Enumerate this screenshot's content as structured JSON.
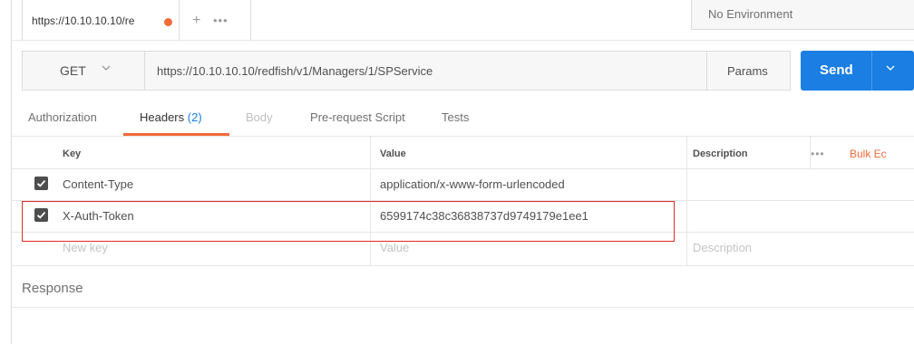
{
  "tabs": [
    {
      "title": "https://10.10.10.10/re",
      "unsaved": true
    }
  ],
  "tab_actions": {
    "add": "+",
    "more": "•••"
  },
  "environment": {
    "selected": "No Environment"
  },
  "request": {
    "method": "GET",
    "url": "https://10.10.10.10/redfish/v1/Managers/1/SPService",
    "params_label": "Params",
    "send_label": "Send"
  },
  "request_tabs": [
    {
      "label": "Authorization",
      "state": "normal"
    },
    {
      "label": "Headers",
      "count": "(2)",
      "state": "active"
    },
    {
      "label": "Body",
      "state": "disabled"
    },
    {
      "label": "Pre-request Script",
      "state": "normal"
    },
    {
      "label": "Tests",
      "state": "normal"
    }
  ],
  "headers_table": {
    "columns": {
      "key": "Key",
      "value": "Value",
      "description": "Description"
    },
    "more": "•••",
    "bulk_edit": "Bulk Ec",
    "rows": [
      {
        "checked": true,
        "key": "Content-Type",
        "value": "application/x-www-form-urlencoded",
        "description": ""
      },
      {
        "checked": true,
        "key": "X-Auth-Token",
        "value": "6599174c38c36838737d9749179e1ee1",
        "description": ""
      }
    ],
    "placeholders": {
      "key": "New key",
      "value": "Value",
      "description": "Description"
    }
  },
  "response": {
    "label": "Response"
  },
  "colors": {
    "accent": "#f26b3a",
    "send": "#1a7ee2",
    "highlight": "#e02b2b"
  },
  "icons": {
    "check": "check-icon",
    "chevron": "chevron-down-icon",
    "unsaved": "unsaved-dot-icon"
  }
}
